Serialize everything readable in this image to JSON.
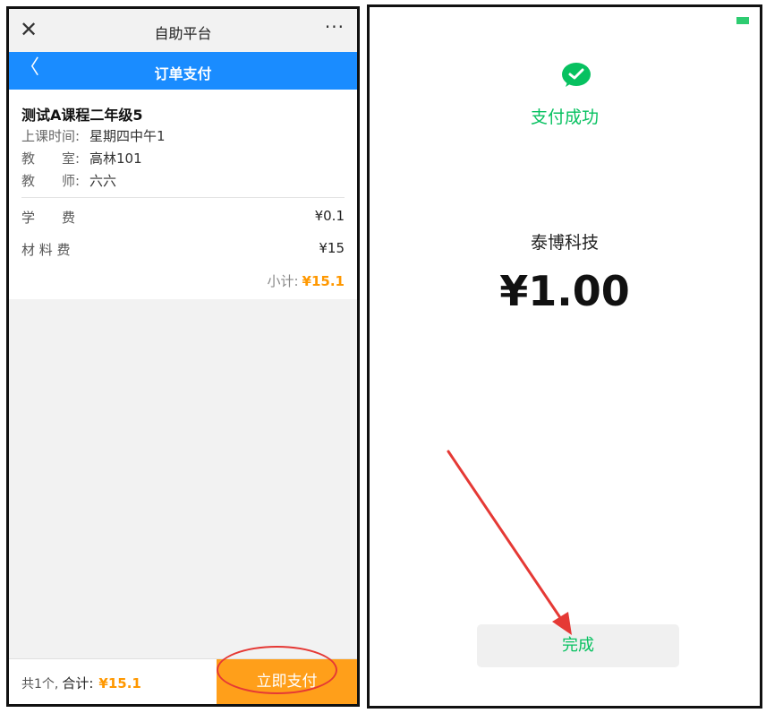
{
  "left": {
    "topbar": {
      "close_icon": "close-icon",
      "title": "自助平台",
      "more_icon": "more-icon",
      "more": "···"
    },
    "navbar": {
      "back": "〈",
      "title": "订单支付"
    },
    "course": {
      "name": "测试A课程二年级5",
      "time_label": "上课时间:",
      "time_value": "星期四中午1",
      "room_label": "教　　室:",
      "room_value": "高林101",
      "teacher_label": "教　　师:",
      "teacher_value": "六六"
    },
    "fees": [
      {
        "label": "学　　费",
        "amount": "¥0.1"
      },
      {
        "label": "材 料 费",
        "amount": "¥15"
      }
    ],
    "subtotal_label": "小计:",
    "subtotal_value": "¥15.1",
    "bottom": {
      "count": "共1个,",
      "total_label": "合计:",
      "total_value": "¥15.1",
      "pay_button": "立即支付"
    },
    "annotation_color": "#e53935"
  },
  "right": {
    "status_color": "#2ecc71",
    "success_icon": "wechat-pay-check-icon",
    "success_text": "支付成功",
    "merchant": "泰博科技",
    "amount": "¥1.00",
    "done_button": "完成",
    "accent": "#07c160",
    "arrow_color": "#e53935"
  }
}
